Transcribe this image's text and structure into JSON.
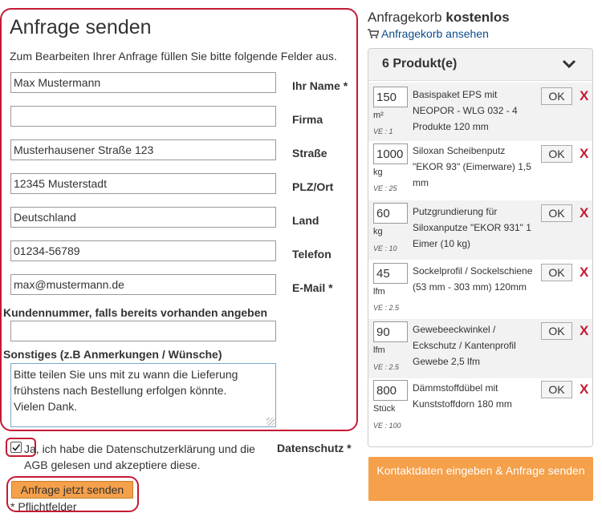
{
  "form": {
    "title": "Anfrage senden",
    "intro": "Zum Bearbeiten Ihrer Anfrage füllen Sie bitte folgende Felder aus.",
    "fields": [
      {
        "label": "Ihr Name *",
        "value": "Max Mustermann"
      },
      {
        "label": "Firma",
        "value": ""
      },
      {
        "label": "Straße",
        "value": "Musterhausener Straße 123"
      },
      {
        "label": "PLZ/Ort",
        "value": "12345 Musterstadt"
      },
      {
        "label": "Land",
        "value": "Deutschland"
      },
      {
        "label": "Telefon",
        "value": "01234-56789"
      },
      {
        "label": "E-Mail *",
        "value": "max@mustermann.de"
      }
    ],
    "customer_number_label": "Kundennummer, falls bereits vorhanden angeben",
    "customer_number_value": "",
    "notes_label": "Sonstiges (z.B Anmerkungen / Wünsche)",
    "notes_value": "Bitte teilen Sie uns mit zu wann die Lieferung frühstens nach Bestellung erfolgen könnte.\nVielen Dank.",
    "privacy_checked": true,
    "privacy_text": "Ja, ich habe die Datenschutzerklärung und die AGB gelesen und akzeptiere diese.",
    "privacy_label": "Datenschutz *",
    "submit_label": "Anfrage jetzt senden",
    "required_note": "* Pflichtfelder"
  },
  "cart": {
    "title_prefix": "Anfragekorb",
    "title_bold": "kostenlos",
    "view_link": "Anfragekorb ansehen",
    "count_label": "6 Produkt(e)",
    "ok_label": "OK",
    "delete_label": "X",
    "items": [
      {
        "qty": "150",
        "unit": "m²",
        "ve": "VE : 1",
        "name": "Basispaket EPS mit NEOPOR - WLG 032 - 4 Produkte 120 mm"
      },
      {
        "qty": "1000",
        "unit": "kg",
        "ve": "VE : 25",
        "name": "Siloxan Scheibenputz \"EKOR 93\" (Eimerware) 1,5 mm"
      },
      {
        "qty": "60",
        "unit": "kg",
        "ve": "VE : 10",
        "name": "Putzgrundierung für Siloxanputze \"EKOR 931\" 1 Eimer (10 kg)"
      },
      {
        "qty": "45",
        "unit": "lfm",
        "ve": "VE : 2.5",
        "name": "Sockelprofil / Sockelschiene (53 mm - 303 mm) 120mm"
      },
      {
        "qty": "90",
        "unit": "lfm",
        "ve": "VE : 2.5",
        "name": "Gewebeeckwinkel / Eckschutz / Kantenprofil Gewebe 2,5 lfm"
      },
      {
        "qty": "800",
        "unit": "Stück",
        "ve": "VE : 100",
        "name": "Dämmstoffdübel mit Kunststoffdorn 180 mm"
      }
    ],
    "cta_label": "Kontaktdaten eingeben & Anfrage senden"
  },
  "colors": {
    "highlight": "#c51a35",
    "accent_orange": "#f5a04a",
    "link_blue": "#0c4c8c"
  },
  "icons": {
    "cart": "shopping-cart-icon",
    "chevron": "chevron-down-icon",
    "checkbox": "checkmark-icon"
  }
}
